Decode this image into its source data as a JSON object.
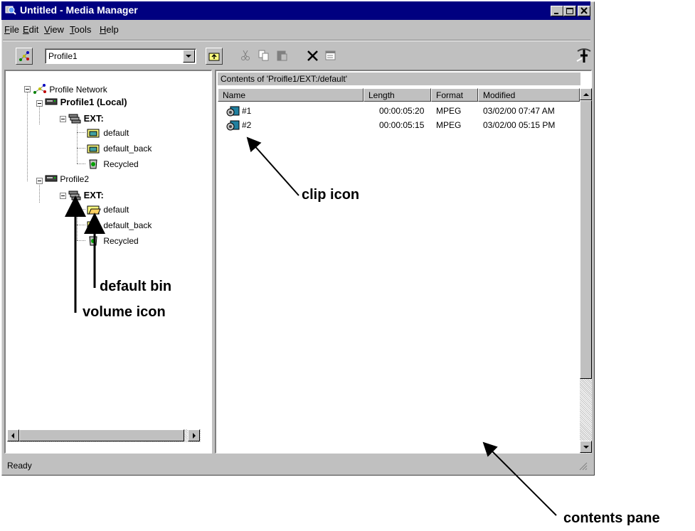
{
  "window": {
    "title": "Untitled - Media Manager"
  },
  "menu": [
    {
      "label": "File",
      "u": "F",
      "rest": "ile"
    },
    {
      "label": "Edit",
      "u": "E",
      "rest": "dit"
    },
    {
      "label": "View",
      "u": "V",
      "rest": "iew"
    },
    {
      "label": "Tools",
      "u": "T",
      "rest": "ools"
    },
    {
      "label": "Help",
      "u": "H",
      "rest": "elp"
    }
  ],
  "toolbar": {
    "profile_selected": "Profile1"
  },
  "tree": {
    "root": "Profile Network",
    "profile1": "Profile1 (Local)",
    "profile1_volume": "EXT:",
    "profile1_bins": [
      "default",
      "default_back",
      "Recycled"
    ],
    "profile2": "Profile2",
    "profile2_volume": "EXT:",
    "profile2_bins": [
      "default",
      "default_back",
      "Recycled"
    ]
  },
  "contents": {
    "caption": "Contents of 'Proifle1/EXT:/default'",
    "columns": [
      "Name",
      "Length",
      "Format",
      "Modified"
    ],
    "rows": [
      {
        "name": "#1",
        "length": "00:00:05:20",
        "format": "MPEG",
        "modified": "03/02/00 07:47 AM"
      },
      {
        "name": "#2",
        "length": "00:00:05:15",
        "format": "MPEG",
        "modified": "03/02/00 05:15 PM"
      }
    ]
  },
  "status": {
    "text": "Ready"
  },
  "callouts": {
    "clip_icon": "clip icon",
    "default_bin": "default bin",
    "volume_icon": "volume icon",
    "contents_pane": "contents pane"
  }
}
